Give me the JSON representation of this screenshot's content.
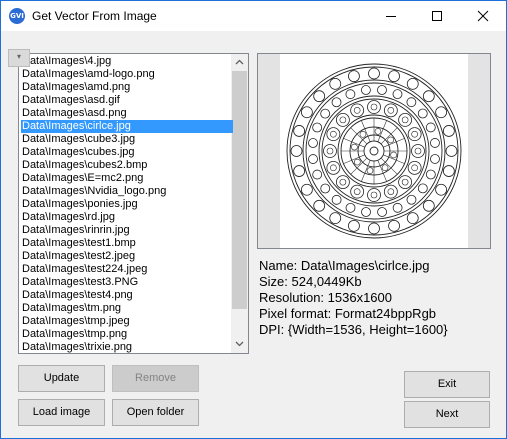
{
  "window": {
    "title": "Get Vector From Image",
    "icon_text": "GVI",
    "title_buttons": [
      "minimize-icon",
      "maximize-icon",
      "close-icon"
    ]
  },
  "files": {
    "items": [
      "Data\\Images\\4.jpg",
      "Data\\Images\\amd-logo.png",
      "Data\\Images\\amd.png",
      "Data\\Images\\asd.gif",
      "Data\\Images\\asd.png",
      "Data\\Images\\cirlce.jpg",
      "Data\\Images\\cube3.jpg",
      "Data\\Images\\cubes.jpg",
      "Data\\Images\\cubes2.bmp",
      "Data\\Images\\E=mc2.png",
      "Data\\Images\\Nvidia_logo.png",
      "Data\\Images\\ponies.jpg",
      "Data\\Images\\rd.jpg",
      "Data\\Images\\rinrin.jpg",
      "Data\\Images\\test1.bmp",
      "Data\\Images\\test2.jpeg",
      "Data\\Images\\test224.jpeg",
      "Data\\Images\\test3.PNG",
      "Data\\Images\\test4.png",
      "Data\\Images\\tm.png",
      "Data\\Images\\tmp.jpeg",
      "Data\\Images\\tmp.png",
      "Data\\Images\\trixie.png"
    ],
    "selected": "Data\\Images\\cirlce.jpg"
  },
  "info": {
    "name": "Name: Data\\Images\\cirlce.jpg",
    "size": "Size: 524,0449Kb",
    "resolution": "Resolution: 1536x1600",
    "pixel_format": "Pixel format: Format24bppRgb",
    "dpi": "DPI: {Width=1536, Height=1600}"
  },
  "buttons": {
    "update": "Update",
    "remove": "Remove",
    "load_image": "Load image",
    "open_folder": "Open folder",
    "exit": "Exit",
    "next": "Next"
  },
  "colors": {
    "selection": "#3399ff",
    "window_bg": "#f0f0f0",
    "border": "#1e6fd9"
  }
}
